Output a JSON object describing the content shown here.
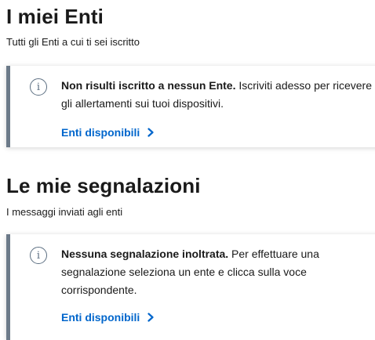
{
  "enti": {
    "title": "I miei Enti",
    "subtitle": "Tutti gli Enti a cui ti sei iscritto",
    "notice": {
      "bold": "Non risulti iscritto a nessun Ente.",
      "text": " Iscriviti adesso per ricevere gli allertamenti sui tuoi dispositivi.",
      "link_label": "Enti disponibili",
      "icon": "info-icon"
    }
  },
  "segnalazioni": {
    "title": "Le mie segnalazioni",
    "subtitle": "I messaggi inviati agli enti",
    "notice": {
      "bold": "Nessuna segnalazione inoltrata.",
      "text": " Per effettuare una segnalazione seleziona un ente e clicca sulla voce corrispondente.",
      "link_label": "Enti disponibili",
      "icon": "info-icon"
    }
  },
  "colors": {
    "link": "#0066cc",
    "border_accent": "#6c7a89",
    "text": "#1a1a1a"
  }
}
